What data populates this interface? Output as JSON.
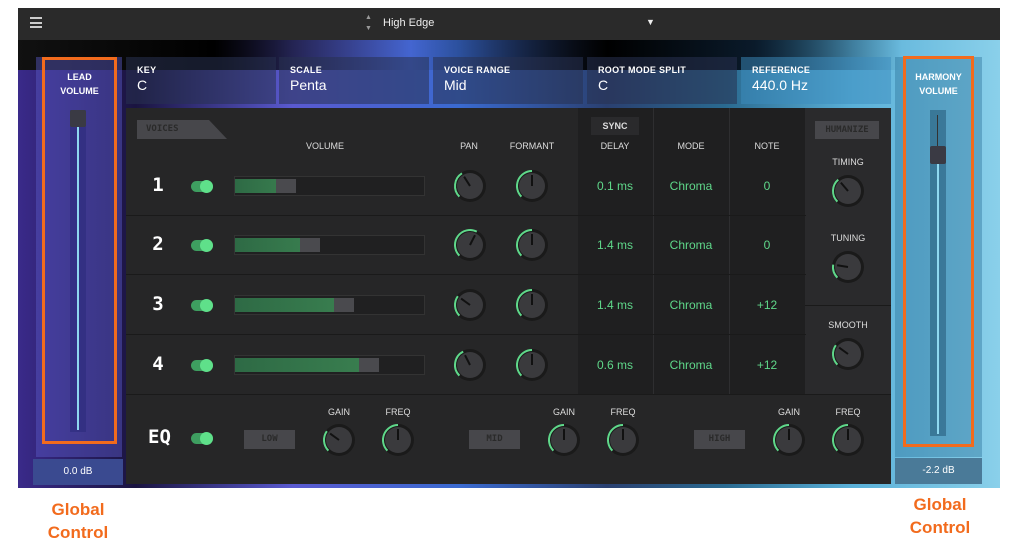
{
  "topbar": {
    "menu_icon": "hamburger-icon",
    "preset": "High Edge"
  },
  "lead": {
    "label1": "LEAD",
    "label2": "VOLUME",
    "value": "0.0 dB",
    "level": 0.95
  },
  "harmony": {
    "label1": "HARMONY",
    "label2": "VOLUME",
    "value": "-2.2 dB",
    "level": 0.85
  },
  "cards": [
    {
      "label": "KEY",
      "value": "C"
    },
    {
      "label": "SCALE",
      "value": "Penta"
    },
    {
      "label": "VOICE RANGE",
      "value": "Mid"
    },
    {
      "label": "ROOT MODE SPLIT",
      "value": "C"
    },
    {
      "label": "REFERENCE",
      "value": "440.0 Hz"
    }
  ],
  "voices": {
    "tab": "VOICES",
    "sync": "SYNC",
    "humanize": "HUMANIZE",
    "headers": {
      "volume": "VOLUME",
      "pan": "PAN",
      "formant": "FORMANT",
      "delay": "DELAY",
      "mode": "MODE",
      "note": "NOTE"
    },
    "rows": [
      {
        "num": "1",
        "volume": 0.31,
        "delay": "0.1 ms",
        "mode": "Chroma",
        "note": "0"
      },
      {
        "num": "2",
        "volume": 0.44,
        "delay": "1.4 ms",
        "mode": "Chroma",
        "note": "0"
      },
      {
        "num": "3",
        "volume": 0.62,
        "delay": "1.4 ms",
        "mode": "Chroma",
        "note": "+12"
      },
      {
        "num": "4",
        "volume": 0.75,
        "delay": "0.6 ms",
        "mode": "Chroma",
        "note": "+12"
      }
    ],
    "humanize_knobs": {
      "timing": "TIMING",
      "tuning": "TUNING",
      "smooth": "SMOOTH"
    }
  },
  "eq": {
    "label": "EQ",
    "bands": [
      {
        "name": "LOW"
      },
      {
        "name": "MID"
      },
      {
        "name": "HIGH"
      }
    ],
    "gain": "GAIN",
    "freq": "FREQ"
  },
  "annotations": {
    "left": "Global Control",
    "right": "Global Control"
  },
  "colors": {
    "accent": "#5fd88a",
    "annotation": "#f26b1d"
  }
}
